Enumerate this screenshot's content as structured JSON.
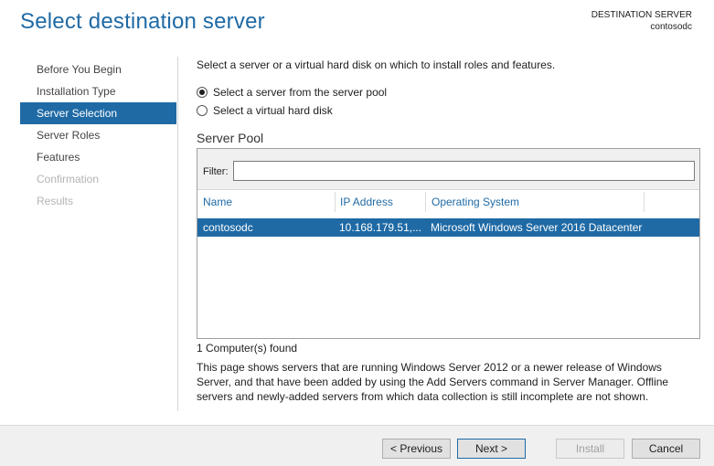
{
  "header": {
    "title": "Select destination server",
    "destination_label": "DESTINATION SERVER",
    "destination_value": "contosodc"
  },
  "sidebar": {
    "items": [
      {
        "label": "Before You Begin",
        "state": "normal"
      },
      {
        "label": "Installation Type",
        "state": "normal"
      },
      {
        "label": "Server Selection",
        "state": "active"
      },
      {
        "label": "Server Roles",
        "state": "normal"
      },
      {
        "label": "Features",
        "state": "normal"
      },
      {
        "label": "Confirmation",
        "state": "disabled"
      },
      {
        "label": "Results",
        "state": "disabled"
      }
    ]
  },
  "main": {
    "intro": "Select a server or a virtual hard disk on which to install roles and features.",
    "options": [
      {
        "label": "Select a server from the server pool",
        "checked": true
      },
      {
        "label": "Select a virtual hard disk",
        "checked": false
      }
    ],
    "pool_title": "Server Pool",
    "filter_label": "Filter:",
    "filter_value": "",
    "columns": [
      "Name",
      "IP Address",
      "Operating System"
    ],
    "rows": [
      {
        "name": "contosodc",
        "ip": "10.168.179.51,...",
        "os": "Microsoft Windows Server 2016 Datacenter",
        "selected": true
      }
    ],
    "found_text": "1 Computer(s) found",
    "description": "This page shows servers that are running Windows Server 2012 or a newer release of Windows Server, and that have been added by using the Add Servers command in Server Manager. Offline servers and newly-added servers from which data collection is still incomplete are not shown."
  },
  "buttons": {
    "previous": "< Previous",
    "next": "Next >",
    "install": "Install",
    "cancel": "Cancel"
  },
  "colors": {
    "accent": "#1f6aa5"
  }
}
